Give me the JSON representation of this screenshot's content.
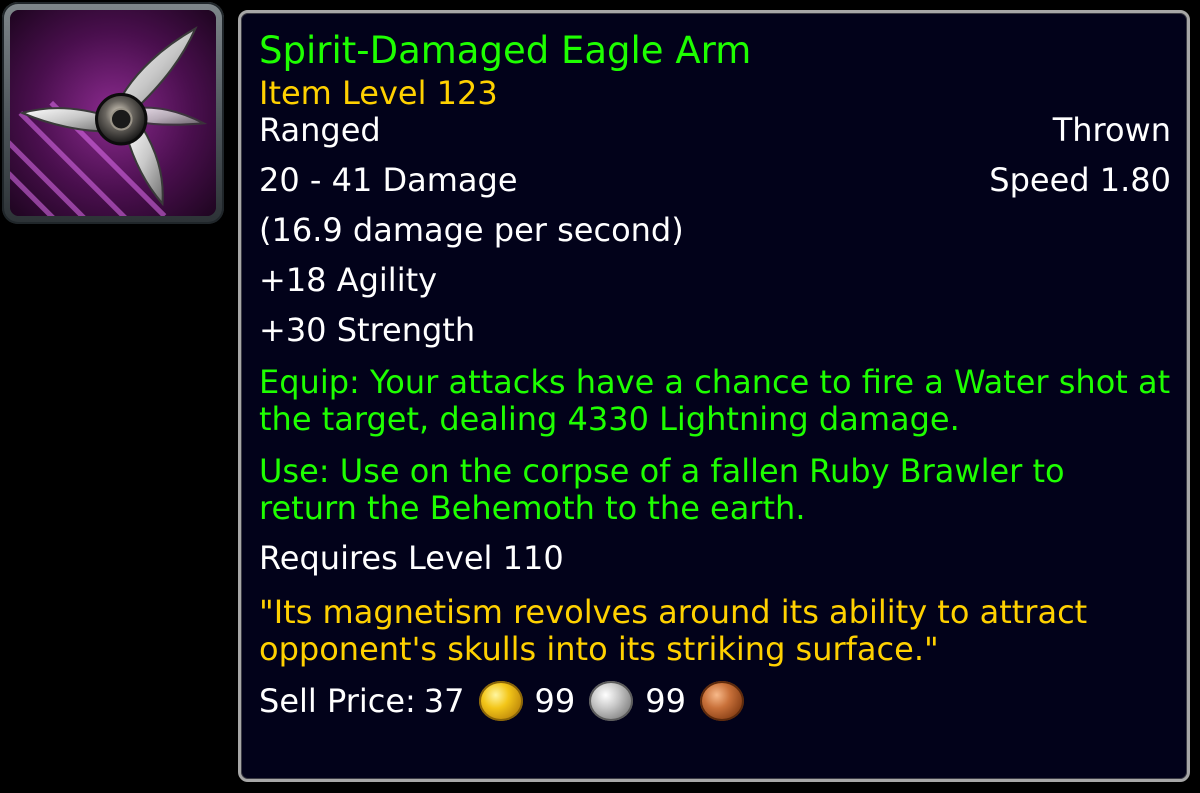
{
  "icon": {
    "name": "throwing-star-icon",
    "colors": {
      "background": "#3a0b3c",
      "glow": "#c04ad8",
      "blade": "#d9d9d9",
      "hub": "#1a1a1a"
    }
  },
  "tooltip": {
    "title": "Spirit-Damaged Eagle Arm",
    "item_level": "Item Level 123",
    "slot": "Ranged",
    "type": "Thrown",
    "damage": "20 - 41 Damage",
    "speed": "Speed 1.80",
    "dps": "(16.9 damage per second)",
    "stats": [
      "+18 Agility",
      "+30 Strength"
    ],
    "equip": "Equip: Your attacks have a chance to fire a Water shot at the target, dealing 4330 Lightning damage.",
    "use": "Use: Use on the corpse of a fallen Ruby Brawler to return the Behemoth to the earth.",
    "requires": "Requires Level 110",
    "flavor": "\"Its magnetism revolves around its ability to attract opponent's skulls into its striking surface.\"",
    "sell": {
      "label": "Sell Price:",
      "gold": "37",
      "silver": "99",
      "copper": "99"
    }
  },
  "colors": {
    "title": "#1eff00",
    "item_level": "#ffd100",
    "text": "#ffffff",
    "effect": "#1eff00",
    "flavor": "#ffd100",
    "background": "#02021a",
    "border": "#a7a7a7"
  }
}
